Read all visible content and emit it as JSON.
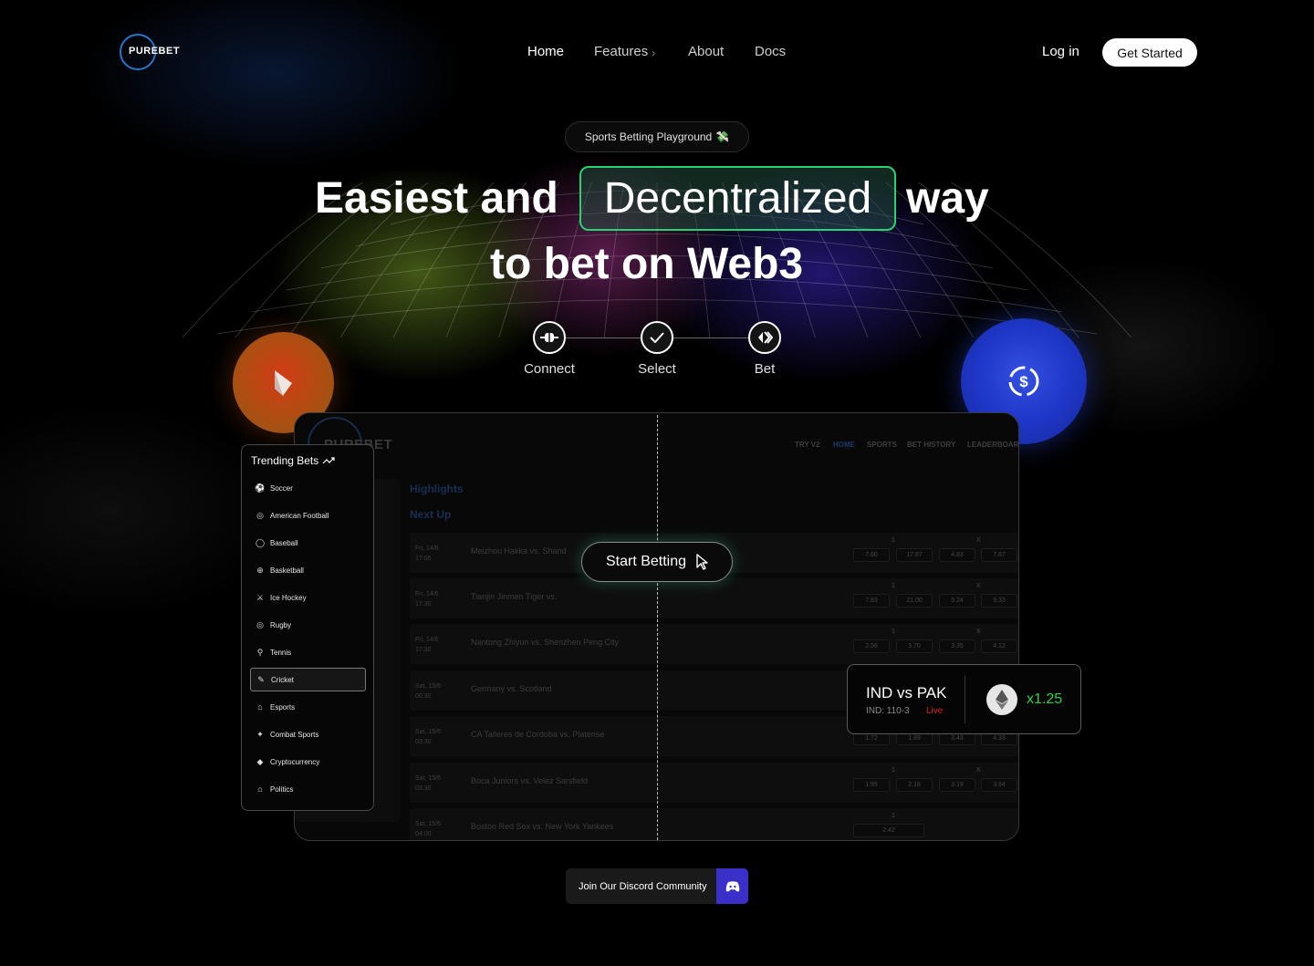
{
  "brand": {
    "logo_text": "PUREBET"
  },
  "nav": {
    "home": "Home",
    "features": "Features",
    "features_chevron": "›",
    "about": "About",
    "docs": "Docs",
    "login": "Log in",
    "get_started": "Get Started"
  },
  "hero": {
    "pill": "Sports Betting Playground",
    "pill_emoji": "💸",
    "title_part1": "Easiest and",
    "title_highlight": "Decentralized",
    "title_part2": "way",
    "title_line2": "to bet on Web3"
  },
  "steps": [
    {
      "label": "Connect",
      "icon": "plug-icon"
    },
    {
      "label": "Select",
      "icon": "check-icon"
    },
    {
      "label": "Bet",
      "icon": "arrows-icon"
    }
  ],
  "app": {
    "logo_text": "PUREBET",
    "nav": [
      "TRY V2",
      "HOME",
      "SPORTS",
      "BET HISTORY",
      "LEADERBOARD"
    ],
    "highlights": "Highlights",
    "next_up": "Next Up",
    "rows": [
      {
        "date": "Fri, 14/6",
        "time": "17:05",
        "match": "Meizhou Hakka vs. Shand",
        "hdr1": "1",
        "hdrx": "X",
        "odds": [
          "7.60",
          "17.67",
          "4.83",
          "7.67"
        ]
      },
      {
        "date": "Fri, 14/6",
        "time": "17:30",
        "match": "Tianjin Jinmen Tiger vs. ",
        "hdr1": "1",
        "hdrx": "X",
        "odds": [
          "7.83",
          "21.00",
          "5.24",
          "9.33"
        ]
      },
      {
        "date": "Fri, 14/6",
        "time": "17:30",
        "match": "Nantong Zhiyun vs. Shenzhen Peng City",
        "hdr1": "1",
        "hdrx": "X",
        "odds": [
          "2.56",
          "3.70",
          "3.35",
          "4.12"
        ]
      },
      {
        "date": "Sat, 15/6",
        "time": "00:30",
        "match": "Germany vs. Scotland",
        "hdr1": "1",
        "hdrx": "X",
        "odds": [
          "",
          "",
          "",
          ""
        ]
      },
      {
        "date": "Sat, 15/6",
        "time": "03:30",
        "match": "CA Talleres de Cordoba vs. Platense",
        "hdr1": "1",
        "hdrx": "X",
        "odds": [
          "1.72",
          "1.89",
          "3.43",
          "4.33"
        ]
      },
      {
        "date": "Sat, 15/6",
        "time": "03:30",
        "match": "Boca Juniors vs. Velez Sarsfield",
        "hdr1": "1",
        "hdrx": "X",
        "odds": [
          "1.95",
          "2.18",
          "3.19",
          "3.94"
        ]
      },
      {
        "date": "Sat, 15/6",
        "time": "04:00",
        "match": "Boston Red Sox vs. New York Yankees",
        "hdr1": "1",
        "hdrx": "",
        "odds": [
          "2.42"
        ]
      }
    ],
    "start_betting": "Start Betting"
  },
  "trending": {
    "title": "Trending Bets",
    "items": [
      {
        "label": "Soccer",
        "icon": "soccer-icon",
        "glyph": "⚽"
      },
      {
        "label": "American Football",
        "icon": "football-icon",
        "glyph": "◎"
      },
      {
        "label": "Baseball",
        "icon": "baseball-icon",
        "glyph": "◯"
      },
      {
        "label": "Basketball",
        "icon": "basketball-icon",
        "glyph": "⊕"
      },
      {
        "label": "Ice Hockey",
        "icon": "hockey-icon",
        "glyph": "⚔"
      },
      {
        "label": "Rugby",
        "icon": "rugby-icon",
        "glyph": "◎"
      },
      {
        "label": "Tennis",
        "icon": "tennis-icon",
        "glyph": "⚲"
      },
      {
        "label": "Cricket",
        "icon": "cricket-icon",
        "glyph": "✎",
        "active": true
      },
      {
        "label": "Esports",
        "icon": "gamepad-icon",
        "glyph": "⌂"
      },
      {
        "label": "Combat Sports",
        "icon": "combat-icon",
        "glyph": "✦"
      },
      {
        "label": "Cryptocurrency",
        "icon": "ethereum-icon",
        "glyph": "◆"
      },
      {
        "label": "Politics",
        "icon": "politics-icon",
        "glyph": "⌂"
      }
    ]
  },
  "live_card": {
    "teams": "IND vs PAK",
    "score": "IND: 110-3",
    "status": "Live",
    "multiplier": "x1.25"
  },
  "discord": {
    "label": "Join Our Discord Community"
  },
  "colors": {
    "accent_green": "#2bd070",
    "live_red": "#e02020",
    "multiplier_green": "#30d040",
    "discord_purple": "#3a30c9"
  }
}
